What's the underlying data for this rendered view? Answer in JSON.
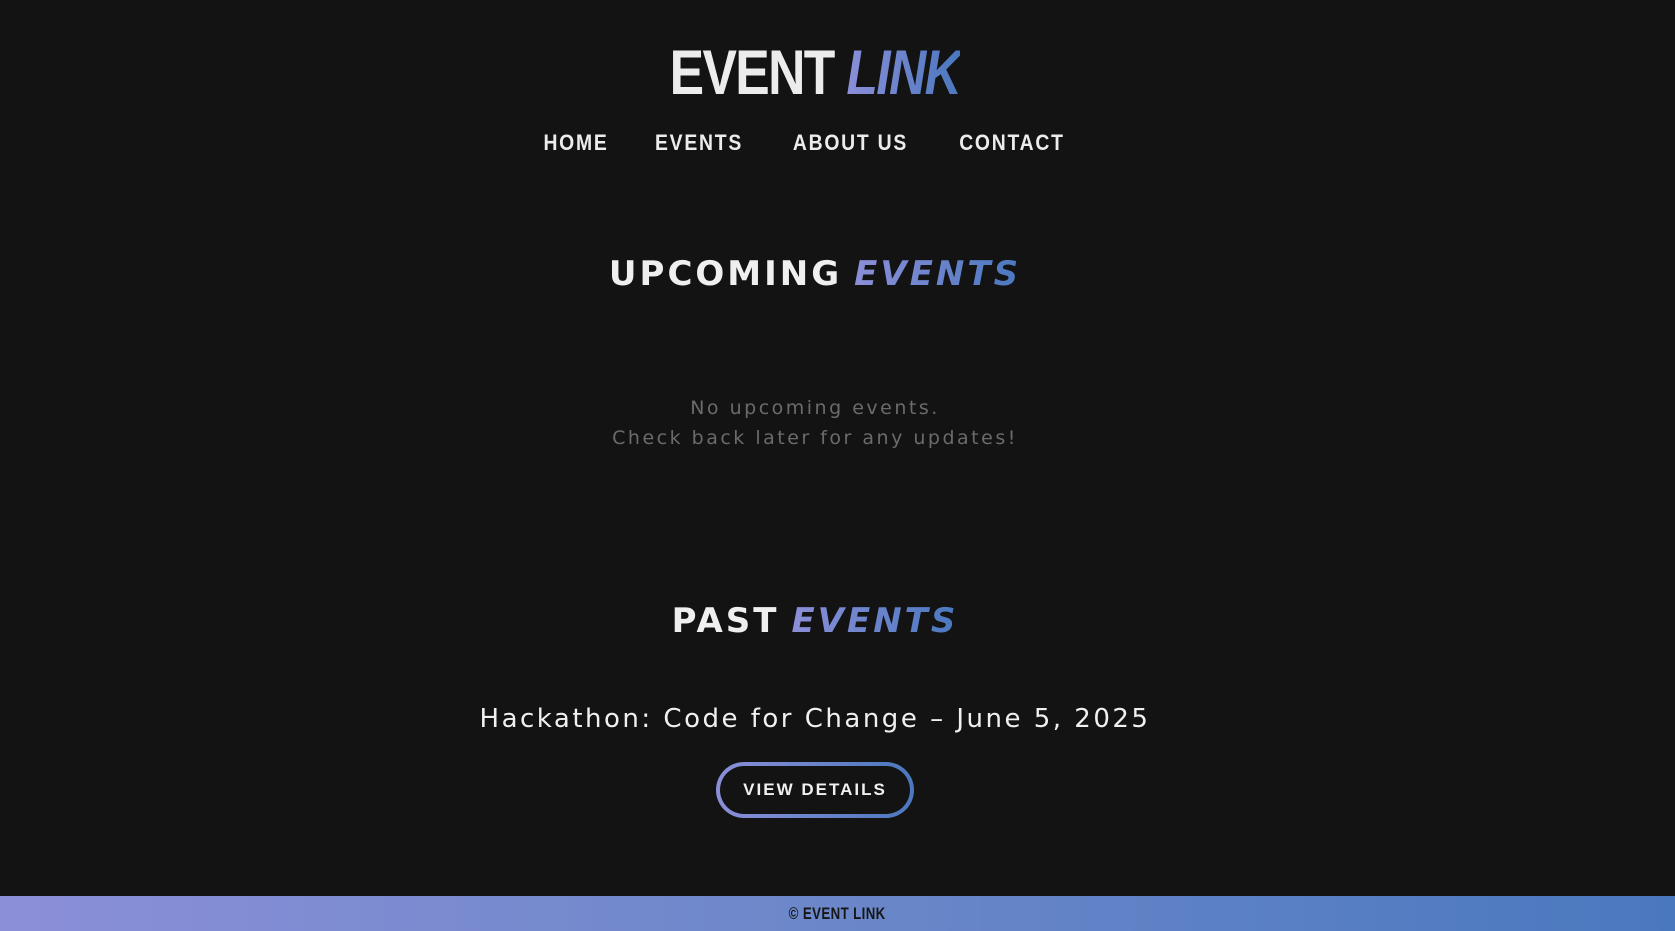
{
  "brand": {
    "logo_part1": "EVENT",
    "logo_part2": "LINK",
    "accent_gradient": [
      "#8b8fd8",
      "#4a78bf"
    ]
  },
  "nav": {
    "items": [
      {
        "label": "HOME"
      },
      {
        "label": "EVENTS"
      },
      {
        "label": "ABOUT US"
      },
      {
        "label": "CONTACT"
      }
    ]
  },
  "upcoming": {
    "title_main": "UPCOMING",
    "title_accent": "EVENTS",
    "empty_line1": "No upcoming events.",
    "empty_line2": "Check back later for any updates!"
  },
  "past": {
    "title_main": "PAST",
    "title_accent": "EVENTS",
    "events": [
      {
        "title": "Hackathon: Code for Change – June 5, 2025",
        "button_label": "VIEW DETAILS"
      }
    ]
  },
  "footer": {
    "text": "© EVENT LINK"
  },
  "colors": {
    "background": "#131313",
    "text": "#ececec",
    "muted_text": "#6b6b6b"
  }
}
